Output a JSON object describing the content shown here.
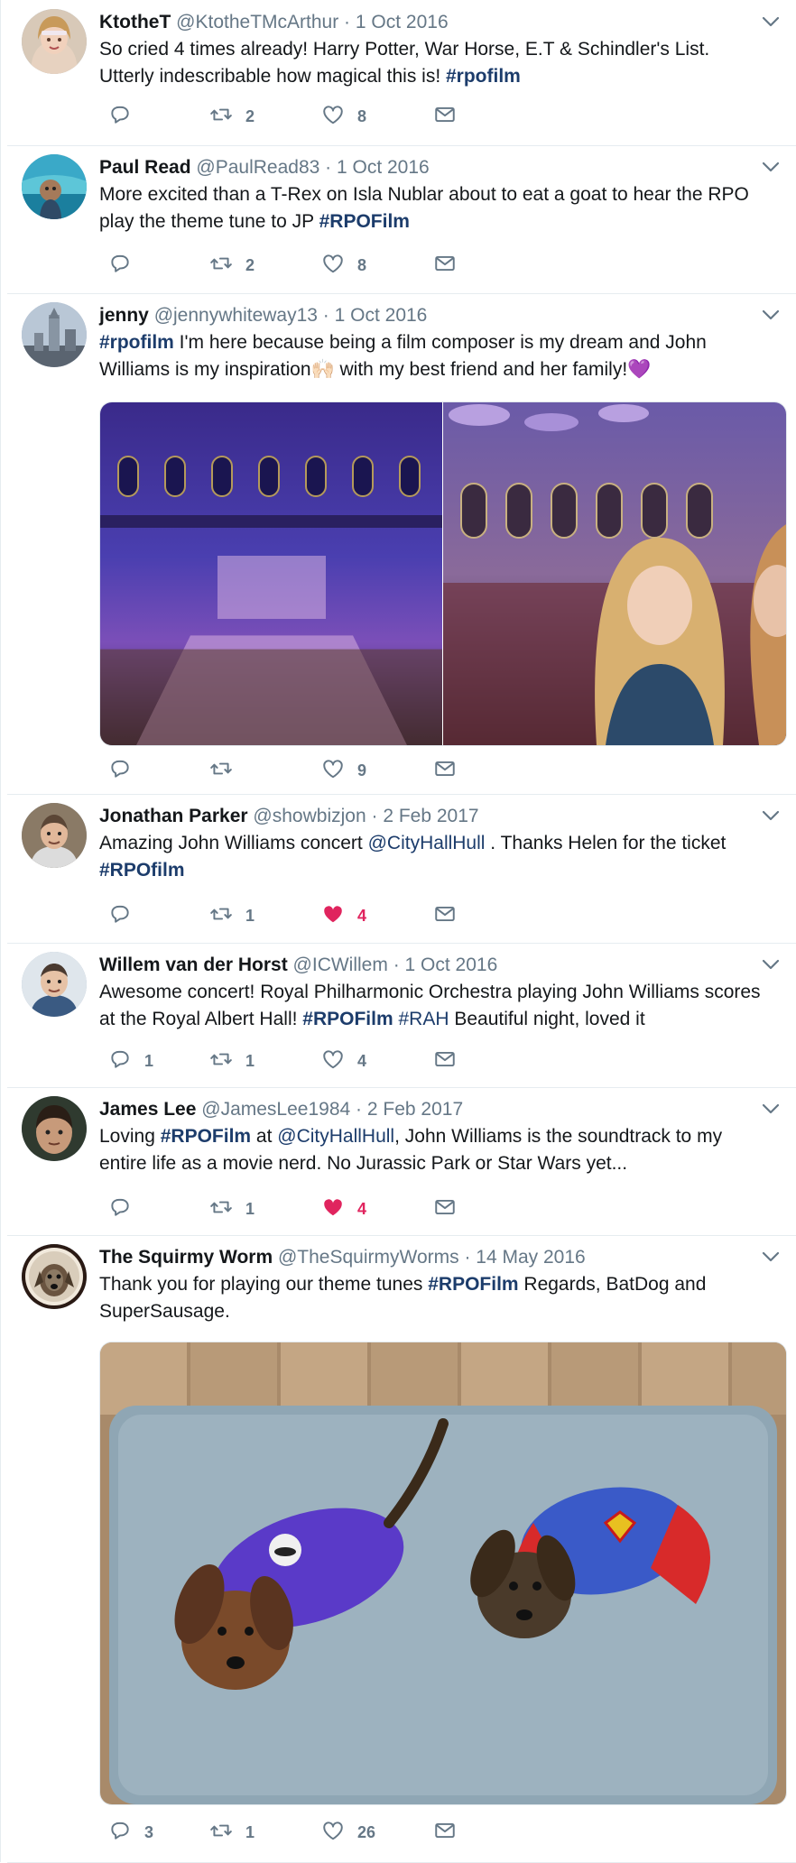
{
  "tweets": [
    {
      "name": "KtotheT",
      "handle": "@KtotheTMcArthur",
      "date": "1 Oct 2016",
      "segments": [
        {
          "t": "So cried 4 times already! Harry Potter, War Horse, E.T & Schindler's List. Utterly indescribable how magical this is! "
        },
        {
          "t": "#rpofilm",
          "tag": true
        }
      ],
      "counts": {
        "reply": "",
        "retweet": "2",
        "like": "8"
      },
      "liked": false
    },
    {
      "name": "Paul Read",
      "handle": "@PaulRead83",
      "date": "1 Oct 2016",
      "segments": [
        {
          "t": "More excited than a T-Rex on Isla Nublar about to eat a goat to hear the RPO play the theme tune to JP "
        },
        {
          "t": "#RPOFilm",
          "tag": true
        }
      ],
      "counts": {
        "reply": "",
        "retweet": "2",
        "like": "8"
      },
      "liked": false
    },
    {
      "name": "jenny",
      "handle": "@jennywhiteway13",
      "date": "1 Oct 2016",
      "segments": [
        {
          "t": "#rpofilm",
          "tag": true
        },
        {
          "t": " I'm here because being a film composer is my dream and John Williams is my inspiration🙌🏻 with my best friend and her family!💜"
        }
      ],
      "counts": {
        "reply": "",
        "retweet": "",
        "like": "9"
      },
      "liked": false
    },
    {
      "name": "Jonathan Parker",
      "handle": "@showbizjon",
      "date": "2 Feb 2017",
      "segments": [
        {
          "t": "Amazing John Williams concert "
        },
        {
          "t": "@CityHallHull",
          "mention": true
        },
        {
          "t": " . Thanks Helen for the ticket "
        },
        {
          "t": "#RPOfilm",
          "tag": true
        }
      ],
      "counts": {
        "reply": "",
        "retweet": "1",
        "like": "4"
      },
      "liked": true
    },
    {
      "name": "Willem van der Horst",
      "handle": "@ICWillem",
      "date": "1 Oct 2016",
      "segments": [
        {
          "t": "Awesome concert! Royal Philharmonic Orchestra playing John Williams scores at the Royal Albert Hall! "
        },
        {
          "t": "#RPOFilm",
          "tag": true
        },
        {
          "t": " "
        },
        {
          "t": "#RAH",
          "mention": true
        },
        {
          "t": " Beautiful night, loved it"
        }
      ],
      "counts": {
        "reply": "1",
        "retweet": "1",
        "like": "4"
      },
      "liked": false
    },
    {
      "name": "James Lee",
      "handle": "@JamesLee1984",
      "date": "2 Feb 2017",
      "segments": [
        {
          "t": "Loving "
        },
        {
          "t": "#RPOFilm",
          "tag": true
        },
        {
          "t": " at "
        },
        {
          "t": "@CityHallHull",
          "mention": true
        },
        {
          "t": ", John Williams is the soundtrack to my entire life as a movie nerd. No Jurassic Park or Star Wars yet..."
        }
      ],
      "counts": {
        "reply": "",
        "retweet": "1",
        "like": "4"
      },
      "liked": true
    },
    {
      "name": "The Squirmy Worm",
      "handle": "@TheSquirmyWorms",
      "date": "14 May 2016",
      "segments": [
        {
          "t": "Thank you for playing our theme tunes "
        },
        {
          "t": "#RPOFilm",
          "tag": true
        },
        {
          "t": " Regards, BatDog and SuperSausage."
        }
      ],
      "counts": {
        "reply": "3",
        "retweet": "1",
        "like": "26"
      },
      "liked": false
    }
  ],
  "colors": {
    "link": "#1c3c6b",
    "muted": "#657786",
    "like_active": "#e0245e",
    "border": "#e6ecf0"
  },
  "icons": {
    "reply": "reply-icon",
    "retweet": "retweet-icon",
    "like": "heart-icon",
    "dm": "envelope-icon",
    "menu": "chevron-down-icon"
  }
}
